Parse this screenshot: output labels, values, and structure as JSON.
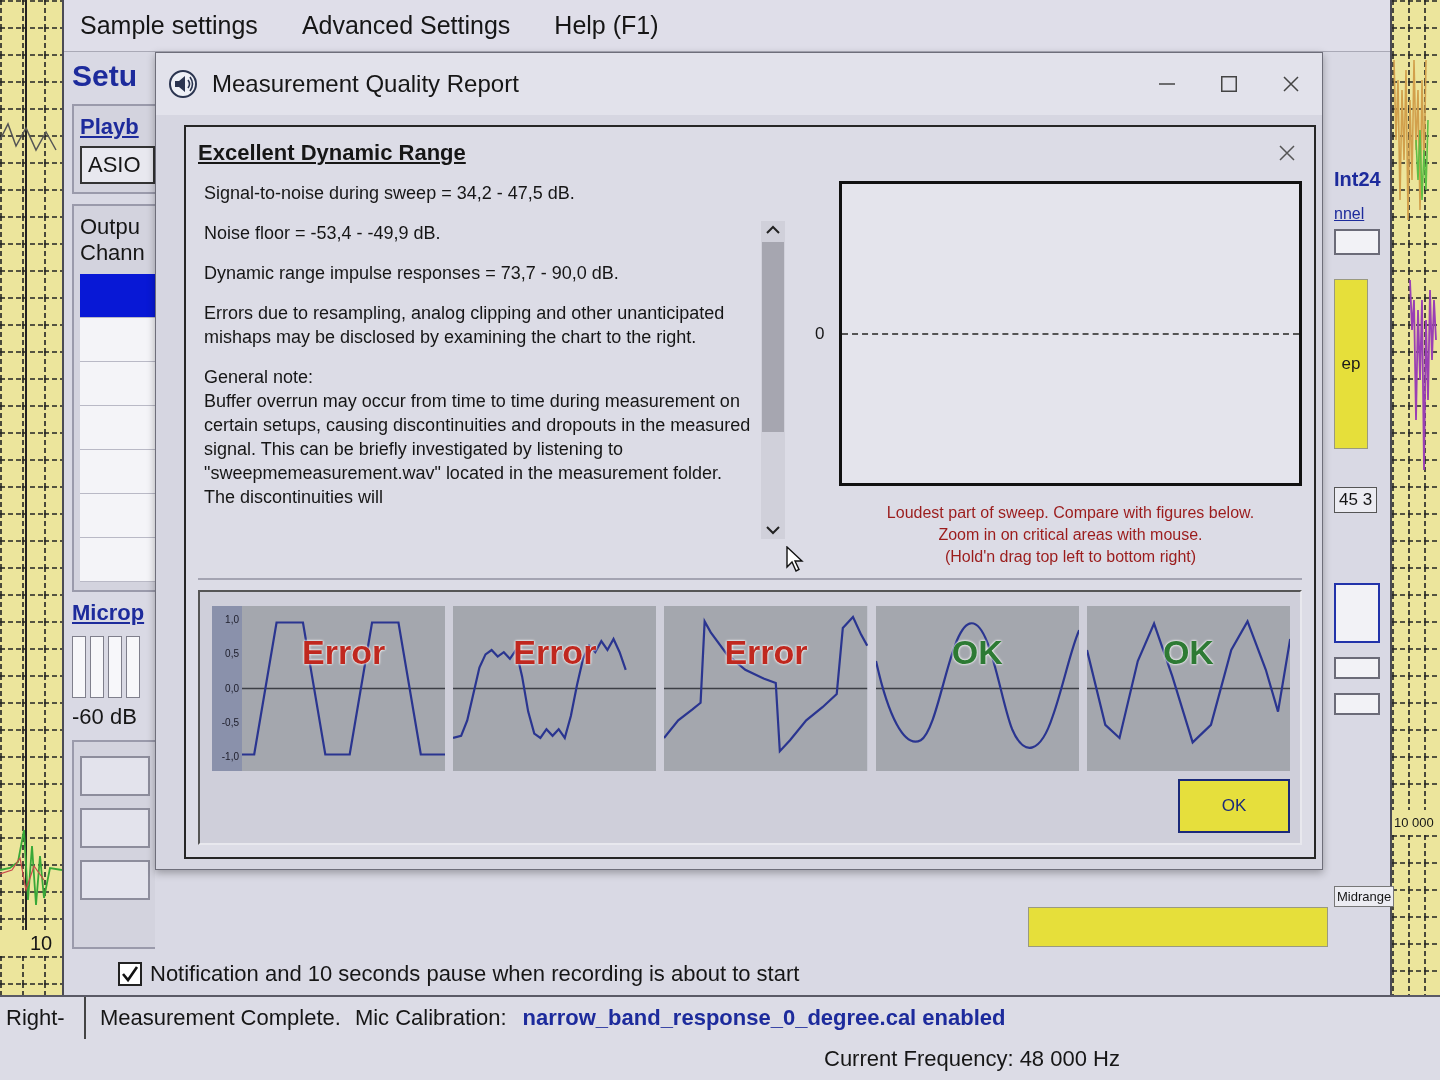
{
  "chart_background": {
    "left_tick": "10",
    "right_tick": "10 000"
  },
  "main_window": {
    "menu": [
      "Sample settings",
      "Advanced Settings",
      "Help (F1)"
    ],
    "left_panel": {
      "title": "Setu",
      "playback_link": "Playb",
      "driver": "ASIO",
      "output_header": [
        "Outpu",
        "Chann"
      ],
      "channel_rows": [
        {
          "selected": true
        },
        {
          "selected": false
        },
        {
          "selected": false
        },
        {
          "selected": false
        },
        {
          "selected": false
        },
        {
          "selected": false
        },
        {
          "selected": false
        }
      ],
      "microphone_link": "Microp",
      "meter_reading": "-60 dB"
    },
    "right_panel": {
      "format": "Int24",
      "channel_link": "nnel",
      "button": "ep",
      "value": "45 3",
      "tag": "Midrange"
    },
    "notification": {
      "label": "Notification and 10 seconds pause when recording is about to start",
      "checked": true
    },
    "status_bar": {
      "side": "Right-",
      "message": "Measurement Complete.",
      "calibration_label": "Mic Calibration:",
      "calibration_file": "narrow_band_response_0_degree.cal enabled",
      "frequency": "Current Frequency: 48 000 Hz"
    }
  },
  "dialog": {
    "title": "Measurement Quality Report",
    "heading": "Excellent Dynamic Range",
    "results": [
      "Signal-to-noise during sweep = 34,2 - 47,5 dB.",
      "Noise floor = -53,4 - -49,9 dB.",
      "Dynamic range impulse responses = 73,7 - 90,0 dB.",
      "Errors due to resampling, analog clipping and other unanticipated mishaps may be disclosed by examining the chart to the right."
    ],
    "note_heading": "General note:",
    "note": "Buffer overrun may occur from time to time during measurement on certain setups, causing discontinuities and dropouts in the measured signal. This can be briefly investigated by listening to \"sweepmemeasurement.wav\" located in the measurement folder. The discontinuities will",
    "plot": {
      "zero_label": "0",
      "caption": [
        "Loudest part of sweep. Compare with figures below.",
        "Zoom in on critical areas with mouse.",
        "(Hold'n drag top left to bottom right)"
      ]
    },
    "examples": {
      "y_ticks": [
        "1,0",
        "0,5",
        "0,0",
        "-0,5",
        "-1,0"
      ],
      "samples": [
        {
          "label": "Error",
          "ok": false,
          "kind": "clipped"
        },
        {
          "label": "Error",
          "ok": false,
          "kind": "distorted"
        },
        {
          "label": "Error",
          "ok": false,
          "kind": "discontinuous"
        },
        {
          "label": "OK",
          "ok": true,
          "kind": "sine"
        },
        {
          "label": "OK",
          "ok": true,
          "kind": "triangle"
        }
      ]
    },
    "ok_button": "OK"
  }
}
